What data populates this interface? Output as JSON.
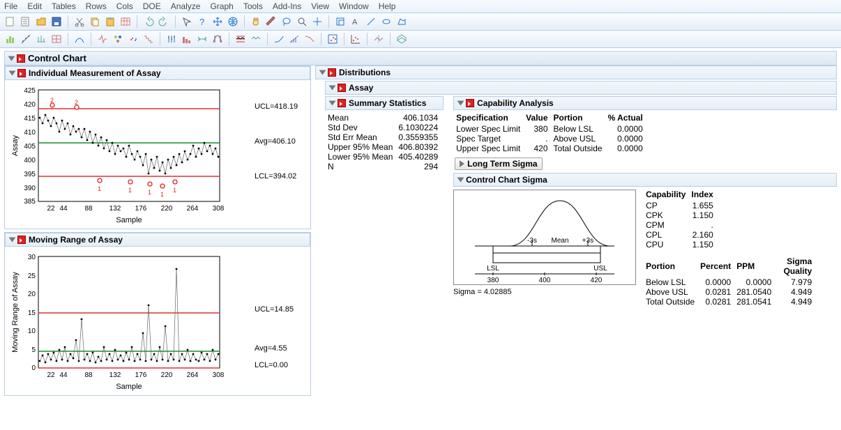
{
  "menus": [
    "File",
    "Edit",
    "Tables",
    "Rows",
    "Cols",
    "DOE",
    "Analyze",
    "Graph",
    "Tools",
    "Add-Ins",
    "View",
    "Window",
    "Help"
  ],
  "outline": {
    "root": "Control Chart",
    "chart1": "Individual Measurement of Assay",
    "chart2": "Moving Range of Assay",
    "dist": "Distributions",
    "assay": "Assay",
    "summary": "Summary Statistics",
    "capability": "Capability Analysis",
    "longterm": "Long Term Sigma",
    "ccsigma": "Control Chart Sigma"
  },
  "chart1": {
    "ylabel": "Assay",
    "xlabel": "Sample",
    "ucl": "UCL=418.19",
    "avg": "Avg=406.10",
    "lcl": "LCL=394.02",
    "yticks": [
      "425",
      "420",
      "415",
      "410",
      "405",
      "400",
      "395",
      "390",
      "385"
    ],
    "xticks": [
      "22",
      "44",
      "88",
      "132",
      "176",
      "220",
      "264",
      "308"
    ]
  },
  "chart2": {
    "ylabel": "Moving Range of Assay",
    "xlabel": "Sample",
    "ucl": "UCL=14.85",
    "avg": "Avg=4.55",
    "lcl": "LCL=0.00",
    "yticks": [
      "30",
      "25",
      "20",
      "15",
      "10",
      "5",
      "0"
    ],
    "xticks": [
      "22",
      "44",
      "88",
      "132",
      "176",
      "220",
      "264",
      "308"
    ]
  },
  "summary_stats": [
    [
      "Mean",
      "406.1034"
    ],
    [
      "Std Dev",
      "6.1030224"
    ],
    [
      "Std Err Mean",
      "0.3559355"
    ],
    [
      "Upper 95% Mean",
      "406.80392"
    ],
    [
      "Lower 95% Mean",
      "405.40289"
    ],
    [
      "N",
      "294"
    ]
  ],
  "cap_spec": {
    "head": [
      "Specification",
      "Value",
      "Portion",
      "% Actual"
    ],
    "rows": [
      [
        "Lower Spec Limit",
        "380",
        "Below LSL",
        "0.0000"
      ],
      [
        "Spec Target",
        ".",
        "Above USL",
        "0.0000"
      ],
      [
        "Upper Spec Limit",
        "420",
        "Total Outside",
        "0.0000"
      ]
    ]
  },
  "sigma_plot": {
    "lsl": "LSL",
    "usl": "USL",
    "mean": "Mean",
    "m3s": "-3s",
    "p3s": "+3s",
    "xticks": [
      "380",
      "400",
      "420"
    ],
    "footer": "Sigma = 4.02885"
  },
  "cap_index": {
    "head": [
      "Capability",
      "Index"
    ],
    "rows": [
      [
        "CP",
        "1.655"
      ],
      [
        "CPK",
        "1.150"
      ],
      [
        "CPM",
        "."
      ],
      [
        "CPL",
        "2.160"
      ],
      [
        "CPU",
        "1.150"
      ]
    ]
  },
  "cap_portion": {
    "head": [
      "Portion",
      "Percent",
      "PPM",
      "Sigma Quality"
    ],
    "rows": [
      [
        "Below LSL",
        "0.0000",
        "0.0000",
        "7.979"
      ],
      [
        "Above USL",
        "0.0281",
        "281.0540",
        "4.949"
      ],
      [
        "Total Outside",
        "0.0281",
        "281.0541",
        "4.949"
      ]
    ]
  },
  "chart_data": [
    {
      "type": "line",
      "title": "Individual Measurement of Assay",
      "xlabel": "Sample",
      "ylabel": "Assay",
      "ylim": [
        385,
        425
      ],
      "xlim": [
        1,
        308
      ],
      "reference_lines": {
        "UCL": 418.19,
        "Avg": 406.1,
        "LCL": 394.02
      },
      "note": "294 jittered points with OOC annotations 1 and 2; approximate slow downward drift from ~415 to ~400"
    },
    {
      "type": "line",
      "title": "Moving Range of Assay",
      "xlabel": "Sample",
      "ylabel": "Moving Range of Assay",
      "ylim": [
        0,
        30
      ],
      "xlim": [
        1,
        308
      ],
      "reference_lines": {
        "UCL": 14.85,
        "Avg": 4.55,
        "LCL": 0.0
      },
      "note": "moving ranges mostly 0–10, spikes ~15–27 at several samples"
    },
    {
      "type": "area",
      "title": "Control Chart Sigma",
      "xlim": [
        370,
        430
      ],
      "annotations": {
        "LSL": 380,
        "USL": 420,
        "Mean": 406.1,
        "-3s": 394.0,
        "+3s": 418.2
      },
      "sigma": 4.02885
    }
  ]
}
